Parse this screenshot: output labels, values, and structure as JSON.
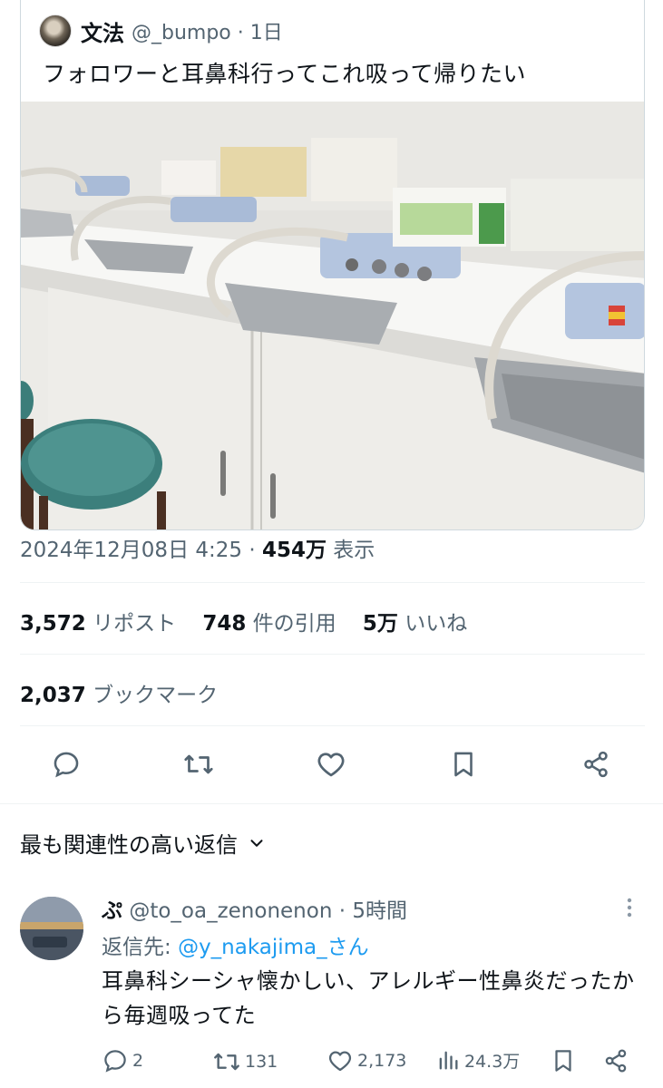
{
  "quoted": {
    "name": "文法",
    "handle": "@_bumpo",
    "time": "1日",
    "text": "フォロワーと耳鼻科行ってこれ吸って帰りたい"
  },
  "post_meta": {
    "datetime": "2024年12月08日 4:25",
    "views_count": "454万",
    "views_label": "表示"
  },
  "stats": {
    "reposts_count": "3,572",
    "reposts_label": "リポスト",
    "quotes_count": "748",
    "quotes_label": "件の引用",
    "likes_count": "5万",
    "likes_label": "いいね",
    "bookmarks_count": "2,037",
    "bookmarks_label": "ブックマーク"
  },
  "actions": [
    "reply-icon",
    "repost-icon",
    "like-icon",
    "bookmark-icon",
    "share-icon"
  ],
  "replies_filter": {
    "label": "最も関連性の高い返信"
  },
  "reply": {
    "name": "ぷ",
    "handle": "@to_oa_zenonenon",
    "time": "5時間",
    "reply_to_label": "返信先:",
    "reply_to_handle": "@y_nakajima_さん",
    "text": "耳鼻科シーシャ懐かしい、アレルギー性鼻炎だったから毎週吸ってた",
    "replies": "2",
    "reposts": "131",
    "likes": "2,173",
    "views": "24.3万"
  },
  "colors": {
    "text": "#0f1419",
    "secondary": "#536471",
    "link": "#1d9bf0",
    "border": "#cfd9de"
  }
}
